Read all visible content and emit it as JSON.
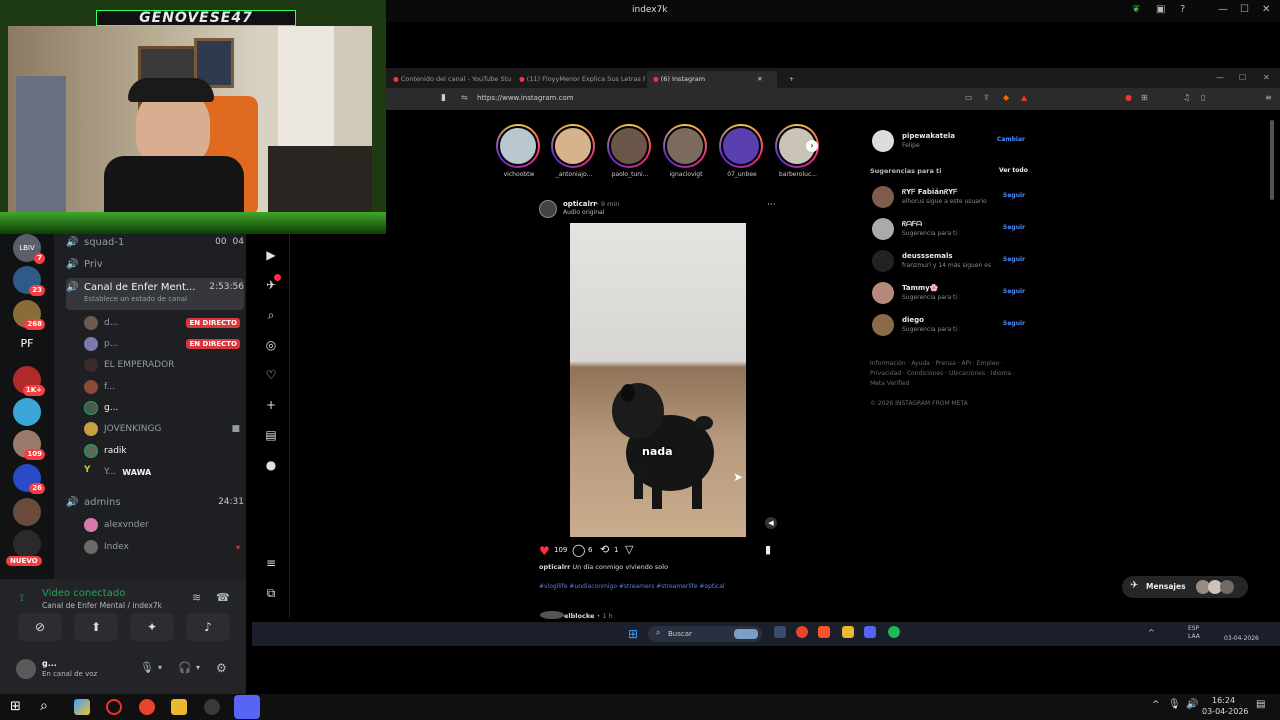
{
  "window": {
    "title": "index7k"
  },
  "webcam": {
    "banner": "GENOVESE47"
  },
  "discord": {
    "servers": [
      {
        "label": "LBIV",
        "badge": "7"
      },
      {
        "label": "",
        "badge": "23"
      },
      {
        "label": "",
        "badge": "268"
      },
      {
        "label": "PF",
        "badge": ""
      },
      {
        "label": "",
        "badge": "1K+"
      },
      {
        "label": "",
        "badge": ""
      },
      {
        "label": "",
        "badge": "109"
      },
      {
        "label": "",
        "badge": "26"
      },
      {
        "label": "",
        "badge": ""
      },
      {
        "label": "",
        "badge": ""
      }
    ],
    "new_badge": "NUEVO",
    "channels": {
      "squad": {
        "name": "squad-1",
        "count_a": "00",
        "count_b": "04"
      },
      "priv": {
        "name": "Priv"
      },
      "active": {
        "name": "Canal de Enfer Ment...",
        "time": "2:53:56",
        "status": "Establece un estado de canal"
      },
      "admins": {
        "name": "admins",
        "time": "24:31"
      }
    },
    "voice_users": [
      {
        "name": "d...",
        "live": "EN DIRECTO"
      },
      {
        "name": "p...",
        "live": "EN DIRECTO"
      },
      {
        "name": "EL EMPERADOR",
        "live": ""
      },
      {
        "name": "f...",
        "live": ""
      },
      {
        "name": "g...",
        "live": ""
      },
      {
        "name": "JOVENKINGG",
        "live": ""
      },
      {
        "name": "radik",
        "live": ""
      },
      {
        "name": "Y...",
        "extra": "WAWA"
      }
    ],
    "admin_users": [
      {
        "name": "alexvnder"
      },
      {
        "name": "Index"
      }
    ],
    "voice_panel": {
      "status": "Video conectado",
      "channel": "Canal de Enfer Mental",
      "channel_suffix": "/ index7k"
    },
    "user_panel": {
      "name": "g...",
      "status": "En canal de voz"
    }
  },
  "browser": {
    "tabs": [
      {
        "label": "Contenido del canal - YouTube Studi"
      },
      {
        "label": "(11) FloyyMenor Explica Sus Letras F"
      },
      {
        "label": "(6) Instagram"
      }
    ],
    "url": "https://www.instagram.com"
  },
  "instagram": {
    "stories": [
      {
        "name": "vichoobtw"
      },
      {
        "name": "_antoniajo..."
      },
      {
        "name": "paolo_tuni..."
      },
      {
        "name": "ignaciovigt"
      },
      {
        "name": "07_unbee"
      },
      {
        "name": "barberoluc..."
      }
    ],
    "post": {
      "author": "opticalrr",
      "time": "• 9 min",
      "audio": "Audio original",
      "overlay": "nada",
      "likes": "109",
      "comments": "6",
      "reposts": "1",
      "caption_user": "opticalrr",
      "caption": "Un día conmigo viviendo solo",
      "tags": "#vlogllife #undiaconmigo #streamers #streamerlife #optical",
      "next_author": "elblocke",
      "next_time": "• 1 h"
    },
    "profile": {
      "user": "pipewakatela",
      "name": "Felipe",
      "switch": "Cambiar"
    },
    "suggestions_header": "Sugerencias para ti",
    "see_all": "Ver todo",
    "follow": "Seguir",
    "suggestions": [
      {
        "name": "ᖇYᖴ FabiánᖇYᖴ",
        "sub": "elhorus sigue a este usuario"
      },
      {
        "name": "ᖇᗩᖴᗩ",
        "sub": "Sugerencia para ti"
      },
      {
        "name": "deusssemals",
        "sub": "franzmuri y 14 más siguen es"
      },
      {
        "name": "Tammy🌸",
        "sub": "Sugerencia para ti"
      },
      {
        "name": "diego",
        "sub": "Sugerencia para ti"
      }
    ],
    "footer_1": "Información · Ayuda · Prensa · API · Empleo ·",
    "footer_2": "Privacidad · Condiciones · Ubicaciones · Idioma ·",
    "footer_3": "Meta Verified",
    "copyright": "© 2026 INSTAGRAM FROM META",
    "messages": "Mensajes"
  },
  "inner_taskbar": {
    "search": "Buscar",
    "lang": "ESP",
    "lang2": "LAA",
    "time": "",
    "date": "03-04-2026"
  },
  "taskbar": {
    "time": "16:24",
    "date": "03-04-2026"
  }
}
